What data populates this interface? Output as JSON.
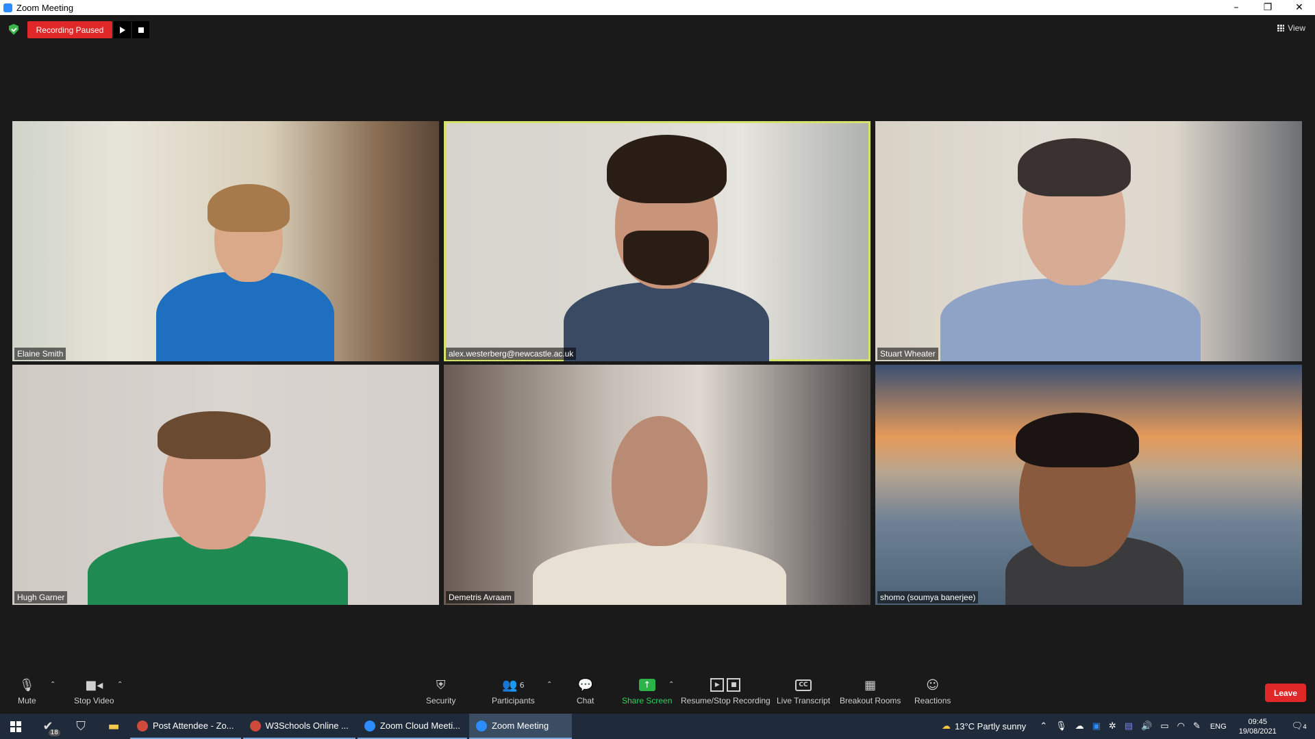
{
  "window": {
    "title": "Zoom Meeting",
    "minimize": "–",
    "maximize": "❐",
    "close": "✕"
  },
  "topbar": {
    "recording_status": "Recording Paused",
    "view_label": "View"
  },
  "participants": [
    {
      "name": "Elaine Smith"
    },
    {
      "name": "alex.westerberg@newcastle.ac.uk"
    },
    {
      "name": "Stuart Wheater"
    },
    {
      "name": "Hugh Garner"
    },
    {
      "name": "Demetris Avraam"
    },
    {
      "name": "shomo (soumya banerjee)"
    }
  ],
  "toolbar": {
    "mute": "Mute",
    "stop_video": "Stop Video",
    "security": "Security",
    "participants": "Participants",
    "participant_count": "6",
    "chat": "Chat",
    "share_screen": "Share Screen",
    "recording": "Resume/Stop Recording",
    "live_transcript": "Live Transcript",
    "breakout_rooms": "Breakout Rooms",
    "reactions": "Reactions",
    "leave": "Leave",
    "cc_text": "CC"
  },
  "taskbar": {
    "badge": "18",
    "apps": [
      {
        "label": "Post Attendee - Zo..."
      },
      {
        "label": "W3Schools Online ..."
      },
      {
        "label": "Zoom Cloud Meeti..."
      },
      {
        "label": "Zoom Meeting"
      }
    ],
    "weather": "13°C  Partly sunny",
    "language": "ENG",
    "time": "09:45",
    "date": "19/08/2021",
    "notifications": "4"
  },
  "colors": {
    "recording_red": "#e02828",
    "share_green": "#2bb34a",
    "active_speaker": "#d6e36a"
  }
}
